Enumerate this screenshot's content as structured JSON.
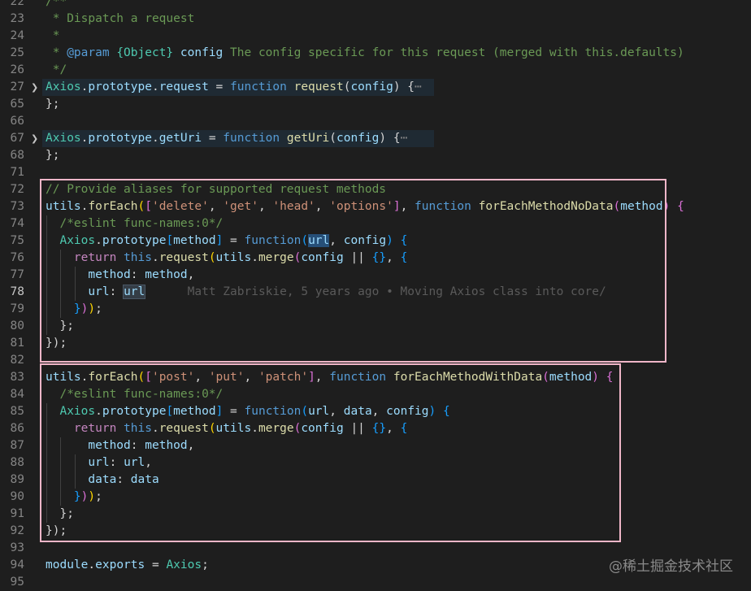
{
  "editor": {
    "lines": [
      {
        "n": "22",
        "fold": false,
        "tokens": [
          [
            "/**",
            "docmarker"
          ]
        ]
      },
      {
        "n": "23",
        "fold": false,
        "tokens": [
          [
            " * Dispatch a request",
            "comment"
          ]
        ]
      },
      {
        "n": "24",
        "fold": false,
        "tokens": [
          [
            " *",
            "comment"
          ]
        ]
      },
      {
        "n": "25",
        "fold": false,
        "tokens": [
          [
            " * ",
            "comment"
          ],
          [
            "@param",
            "doctag"
          ],
          [
            " ",
            "comment"
          ],
          [
            "{Object}",
            "doctype"
          ],
          [
            " ",
            "comment"
          ],
          [
            "config",
            "docparam"
          ],
          [
            " The config specific for this request (merged with this.defaults)",
            "comment"
          ]
        ]
      },
      {
        "n": "26",
        "fold": false,
        "tokens": [
          [
            " */",
            "comment"
          ]
        ]
      },
      {
        "n": "27",
        "fold": true,
        "hl": true,
        "tokens": [
          [
            "Axios",
            "class"
          ],
          [
            ".",
            "text"
          ],
          [
            "prototype",
            "prop"
          ],
          [
            ".",
            "text"
          ],
          [
            "request",
            "prop"
          ],
          [
            " = ",
            "text"
          ],
          [
            "function",
            "keyword"
          ],
          [
            " ",
            "text"
          ],
          [
            "request",
            "func"
          ],
          [
            "(",
            "text"
          ],
          [
            "config",
            "var"
          ],
          [
            ") {",
            "text"
          ],
          [
            "⋯",
            "fold"
          ]
        ]
      },
      {
        "n": "65",
        "fold": false,
        "tokens": [
          [
            "};",
            "text"
          ]
        ]
      },
      {
        "n": "66",
        "fold": false,
        "tokens": []
      },
      {
        "n": "67",
        "fold": true,
        "hl": true,
        "tokens": [
          [
            "Axios",
            "class"
          ],
          [
            ".",
            "text"
          ],
          [
            "prototype",
            "prop"
          ],
          [
            ".",
            "text"
          ],
          [
            "getUri",
            "prop"
          ],
          [
            " = ",
            "text"
          ],
          [
            "function",
            "keyword"
          ],
          [
            " ",
            "text"
          ],
          [
            "getUri",
            "func"
          ],
          [
            "(",
            "text"
          ],
          [
            "config",
            "var"
          ],
          [
            ") {",
            "text"
          ],
          [
            "⋯",
            "fold"
          ]
        ]
      },
      {
        "n": "68",
        "fold": false,
        "tokens": [
          [
            "};",
            "text"
          ]
        ]
      },
      {
        "n": "71",
        "fold": false,
        "tokens": []
      },
      {
        "n": "72",
        "fold": false,
        "tokens": [
          [
            "// Provide aliases for supported request methods",
            "comment"
          ]
        ]
      },
      {
        "n": "73",
        "fold": false,
        "tokens": [
          [
            "utils",
            "var"
          ],
          [
            ".",
            "text"
          ],
          [
            "forEach",
            "func"
          ],
          [
            "(",
            "brace"
          ],
          [
            "[",
            "paren"
          ],
          [
            "'delete'",
            "string"
          ],
          [
            ", ",
            "text"
          ],
          [
            "'get'",
            "string"
          ],
          [
            ", ",
            "text"
          ],
          [
            "'head'",
            "string"
          ],
          [
            ", ",
            "text"
          ],
          [
            "'options'",
            "string"
          ],
          [
            "]",
            "paren"
          ],
          [
            ", ",
            "text"
          ],
          [
            "function",
            "keyword"
          ],
          [
            " ",
            "text"
          ],
          [
            "forEachMethodNoData",
            "func"
          ],
          [
            "(",
            "paren"
          ],
          [
            "method",
            "var"
          ],
          [
            ")",
            "paren"
          ],
          [
            " ",
            "text"
          ],
          [
            "{",
            "paren"
          ]
        ]
      },
      {
        "n": "74",
        "fold": false,
        "tokens": [
          [
            "  ",
            "text"
          ],
          [
            "/*eslint func-names:0*/",
            "comment"
          ]
        ]
      },
      {
        "n": "75",
        "fold": false,
        "tokens": [
          [
            "  ",
            "text"
          ],
          [
            "Axios",
            "class"
          ],
          [
            ".",
            "text"
          ],
          [
            "prototype",
            "prop"
          ],
          [
            "[",
            "bracket"
          ],
          [
            "method",
            "var"
          ],
          [
            "]",
            "bracket"
          ],
          [
            " = ",
            "text"
          ],
          [
            "function",
            "keyword"
          ],
          [
            "(",
            "bracket"
          ],
          [
            "url",
            "selected"
          ],
          [
            ", ",
            "text"
          ],
          [
            "config",
            "var"
          ],
          [
            ")",
            "bracket"
          ],
          [
            " ",
            "text"
          ],
          [
            "{",
            "bracket"
          ]
        ]
      },
      {
        "n": "76",
        "fold": false,
        "tokens": [
          [
            "    ",
            "text"
          ],
          [
            "return",
            "control"
          ],
          [
            " ",
            "text"
          ],
          [
            "this",
            "keyword"
          ],
          [
            ".",
            "text"
          ],
          [
            "request",
            "func"
          ],
          [
            "(",
            "brace"
          ],
          [
            "utils",
            "var"
          ],
          [
            ".",
            "text"
          ],
          [
            "merge",
            "func"
          ],
          [
            "(",
            "paren"
          ],
          [
            "config",
            "var"
          ],
          [
            " || ",
            "text"
          ],
          [
            "{}",
            "bracket"
          ],
          [
            ", ",
            "text"
          ],
          [
            "{",
            "bracket"
          ]
        ]
      },
      {
        "n": "77",
        "fold": false,
        "tokens": [
          [
            "      ",
            "text"
          ],
          [
            "method",
            "prop"
          ],
          [
            ": ",
            "text"
          ],
          [
            "method",
            "var"
          ],
          [
            ",",
            "text"
          ]
        ]
      },
      {
        "n": "78",
        "fold": false,
        "current": true,
        "tokens": [
          [
            "      ",
            "text"
          ],
          [
            "url",
            "prop"
          ],
          [
            ": ",
            "text"
          ],
          [
            "url",
            "wordhl"
          ],
          [
            "      ",
            "text"
          ],
          [
            "Matt Zabriskie, 5 years ago • Moving Axios class into core/",
            "blame"
          ]
        ]
      },
      {
        "n": "79",
        "fold": false,
        "tokens": [
          [
            "    ",
            "text"
          ],
          [
            "}",
            "bracket"
          ],
          [
            ")",
            "paren"
          ],
          [
            ")",
            "brace"
          ],
          [
            ";",
            "text"
          ]
        ]
      },
      {
        "n": "80",
        "fold": false,
        "tokens": [
          [
            "  ",
            "text"
          ],
          [
            "};",
            "text"
          ]
        ]
      },
      {
        "n": "81",
        "fold": false,
        "tokens": [
          [
            "});",
            "text"
          ]
        ]
      },
      {
        "n": "82",
        "fold": false,
        "tokens": []
      },
      {
        "n": "83",
        "fold": false,
        "tokens": [
          [
            "utils",
            "var"
          ],
          [
            ".",
            "text"
          ],
          [
            "forEach",
            "func"
          ],
          [
            "(",
            "brace"
          ],
          [
            "[",
            "paren"
          ],
          [
            "'post'",
            "string"
          ],
          [
            ", ",
            "text"
          ],
          [
            "'put'",
            "string"
          ],
          [
            ", ",
            "text"
          ],
          [
            "'patch'",
            "string"
          ],
          [
            "]",
            "paren"
          ],
          [
            ", ",
            "text"
          ],
          [
            "function",
            "keyword"
          ],
          [
            " ",
            "text"
          ],
          [
            "forEachMethodWithData",
            "func"
          ],
          [
            "(",
            "paren"
          ],
          [
            "method",
            "var"
          ],
          [
            ")",
            "paren"
          ],
          [
            " ",
            "text"
          ],
          [
            "{",
            "paren"
          ]
        ]
      },
      {
        "n": "84",
        "fold": false,
        "tokens": [
          [
            "  ",
            "text"
          ],
          [
            "/*eslint func-names:0*/",
            "comment"
          ]
        ]
      },
      {
        "n": "85",
        "fold": false,
        "tokens": [
          [
            "  ",
            "text"
          ],
          [
            "Axios",
            "class"
          ],
          [
            ".",
            "text"
          ],
          [
            "prototype",
            "prop"
          ],
          [
            "[",
            "bracket"
          ],
          [
            "method",
            "var"
          ],
          [
            "]",
            "bracket"
          ],
          [
            " = ",
            "text"
          ],
          [
            "function",
            "keyword"
          ],
          [
            "(",
            "bracket"
          ],
          [
            "url",
            "var"
          ],
          [
            ", ",
            "text"
          ],
          [
            "data",
            "var"
          ],
          [
            ", ",
            "text"
          ],
          [
            "config",
            "var"
          ],
          [
            ")",
            "bracket"
          ],
          [
            " ",
            "text"
          ],
          [
            "{",
            "bracket"
          ]
        ]
      },
      {
        "n": "86",
        "fold": false,
        "tokens": [
          [
            "    ",
            "text"
          ],
          [
            "return",
            "control"
          ],
          [
            " ",
            "text"
          ],
          [
            "this",
            "keyword"
          ],
          [
            ".",
            "text"
          ],
          [
            "request",
            "func"
          ],
          [
            "(",
            "brace"
          ],
          [
            "utils",
            "var"
          ],
          [
            ".",
            "text"
          ],
          [
            "merge",
            "func"
          ],
          [
            "(",
            "paren"
          ],
          [
            "config",
            "var"
          ],
          [
            " || ",
            "text"
          ],
          [
            "{}",
            "bracket"
          ],
          [
            ", ",
            "text"
          ],
          [
            "{",
            "bracket"
          ]
        ]
      },
      {
        "n": "87",
        "fold": false,
        "tokens": [
          [
            "      ",
            "text"
          ],
          [
            "method",
            "prop"
          ],
          [
            ": ",
            "text"
          ],
          [
            "method",
            "var"
          ],
          [
            ",",
            "text"
          ]
        ]
      },
      {
        "n": "88",
        "fold": false,
        "tokens": [
          [
            "      ",
            "text"
          ],
          [
            "url",
            "prop"
          ],
          [
            ": ",
            "text"
          ],
          [
            "url",
            "var"
          ],
          [
            ",",
            "text"
          ]
        ]
      },
      {
        "n": "89",
        "fold": false,
        "tokens": [
          [
            "      ",
            "text"
          ],
          [
            "data",
            "prop"
          ],
          [
            ": ",
            "text"
          ],
          [
            "data",
            "var"
          ]
        ]
      },
      {
        "n": "90",
        "fold": false,
        "tokens": [
          [
            "    ",
            "text"
          ],
          [
            "}",
            "bracket"
          ],
          [
            ")",
            "paren"
          ],
          [
            ")",
            "brace"
          ],
          [
            ";",
            "text"
          ]
        ]
      },
      {
        "n": "91",
        "fold": false,
        "tokens": [
          [
            "  ",
            "text"
          ],
          [
            "};",
            "text"
          ]
        ]
      },
      {
        "n": "92",
        "fold": false,
        "tokens": [
          [
            "});",
            "text"
          ]
        ]
      },
      {
        "n": "93",
        "fold": false,
        "tokens": []
      },
      {
        "n": "94",
        "fold": false,
        "tokens": [
          [
            "module",
            "var"
          ],
          [
            ".",
            "text"
          ],
          [
            "exports",
            "prop"
          ],
          [
            " = ",
            "text"
          ],
          [
            "Axios",
            "class"
          ],
          [
            ";",
            "text"
          ]
        ]
      },
      {
        "n": "95",
        "fold": false,
        "tokens": []
      }
    ]
  },
  "watermark": "@稀土掘金技术社区",
  "colors": {
    "background": "#1e1e1e",
    "highlight_box": "#f0b6c8"
  }
}
